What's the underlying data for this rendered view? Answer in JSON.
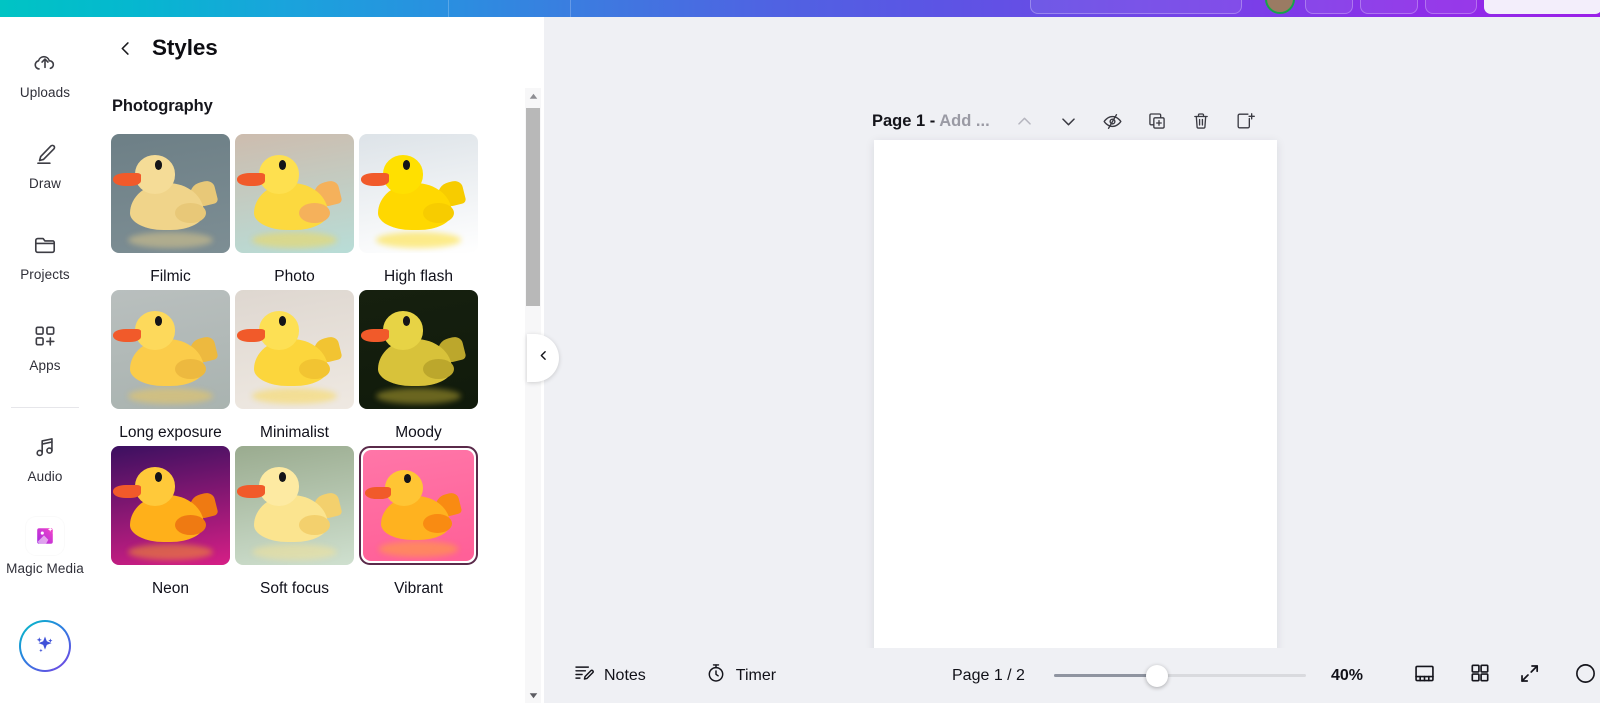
{
  "topbar": {
    "gradient_start": "#00c4c4",
    "gradient_end": "#9b1fe8",
    "avatar_ring_color": "#16a34a"
  },
  "sidebar": {
    "items": [
      {
        "label": "Uploads",
        "icon": "cloud-upload-icon",
        "active": false
      },
      {
        "label": "Draw",
        "icon": "pen-draw-icon",
        "active": false
      },
      {
        "label": "Projects",
        "icon": "folder-icon",
        "active": false
      },
      {
        "label": "Apps",
        "icon": "apps-grid-plus-icon",
        "active": false
      },
      {
        "label": "Audio",
        "icon": "music-note-icon",
        "active": false
      },
      {
        "label": "Magic Media",
        "icon": "magic-media-icon",
        "active": true
      }
    ],
    "ai_button": {
      "icon": "sparkles-icon",
      "label": ""
    }
  },
  "panel": {
    "back_icon": "chevron-left-icon",
    "title": "Styles",
    "section_title": "Photography",
    "styles": [
      {
        "label": "Filmic",
        "selected": false,
        "bg": "#6d7f86",
        "body": "#f0d48a",
        "head": "#f5dc97",
        "wing": "#e8c878",
        "water": "#7d8e94"
      },
      {
        "label": "Photo",
        "selected": false,
        "bg": "#cdbcae",
        "body": "#fcd93f",
        "head": "#fee04f",
        "wing": "#f5b15b",
        "water": "#b8ddd7"
      },
      {
        "label": "High flash",
        "selected": false,
        "bg": "#dde3e8",
        "body": "#ffd800",
        "head": "#ffe000",
        "wing": "#f7cc00",
        "water": "#ffffff"
      },
      {
        "label": "Long exposure",
        "selected": false,
        "bg": "#b9bfbe",
        "body": "#fbcc4a",
        "head": "#fdd95b",
        "wing": "#edb93f",
        "water": "#a9b3b0"
      },
      {
        "label": "Minimalist",
        "selected": false,
        "bg": "#ded7d0",
        "body": "#fcd63c",
        "head": "#fde054",
        "wing": "#f2c432",
        "water": "#efe9e2"
      },
      {
        "label": "Moody",
        "selected": false,
        "bg": "#16200f",
        "body": "#d8c23a",
        "head": "#e7d345",
        "wing": "#bca72c",
        "water": "#101a0b"
      },
      {
        "label": "Neon",
        "selected": false,
        "bg": "#3b1060",
        "body": "#ffb01a",
        "head": "#ffc93a",
        "wing": "#ef7a12",
        "water": "#d61f86"
      },
      {
        "label": "Soft focus",
        "selected": false,
        "bg": "#9aab8f",
        "body": "#fbe48f",
        "head": "#fdeaa2",
        "wing": "#f3d06d",
        "water": "#cfe0cf"
      },
      {
        "label": "Vibrant",
        "selected": true,
        "bg": "#ff76a8",
        "body": "#ffb21f",
        "head": "#ffc534",
        "wing": "#f98b12",
        "water": "#ff5f97"
      }
    ],
    "selection_color": "#5a2a4a",
    "scrollbar": {
      "up_icon": "scroll-up-arrow-icon",
      "down_icon": "scroll-down-arrow-icon"
    },
    "collapse_icon": "chevron-left-icon"
  },
  "editor": {
    "page_header": {
      "title": "Page 1 - ",
      "title_placeholder": "Add ...",
      "actions": [
        {
          "icon": "chevron-up-icon",
          "name": "move-page-up-button",
          "disabled": true
        },
        {
          "icon": "chevron-down-icon",
          "name": "move-page-down-button",
          "disabled": false
        },
        {
          "icon": "eye-slash-icon",
          "name": "hide-page-button",
          "disabled": false
        },
        {
          "icon": "duplicate-page-icon",
          "name": "duplicate-page-button",
          "disabled": false
        },
        {
          "icon": "trash-icon",
          "name": "delete-page-button",
          "disabled": false
        },
        {
          "icon": "add-page-icon",
          "name": "add-page-button",
          "disabled": false
        }
      ]
    },
    "canvas": {
      "background": "#ffffff"
    }
  },
  "bottombar": {
    "notes": {
      "label": "Notes",
      "icon": "notes-icon"
    },
    "timer": {
      "label": "Timer",
      "icon": "timer-icon"
    },
    "page_count": "Page 1 / 2",
    "zoom": {
      "value": "40%",
      "percent": 40
    },
    "view_buttons": [
      {
        "name": "presenter-view-button",
        "icon": "presenter-view-icon"
      },
      {
        "name": "grid-view-button",
        "icon": "grid-view-icon"
      },
      {
        "name": "fullscreen-button",
        "icon": "fullscreen-icon"
      }
    ]
  }
}
